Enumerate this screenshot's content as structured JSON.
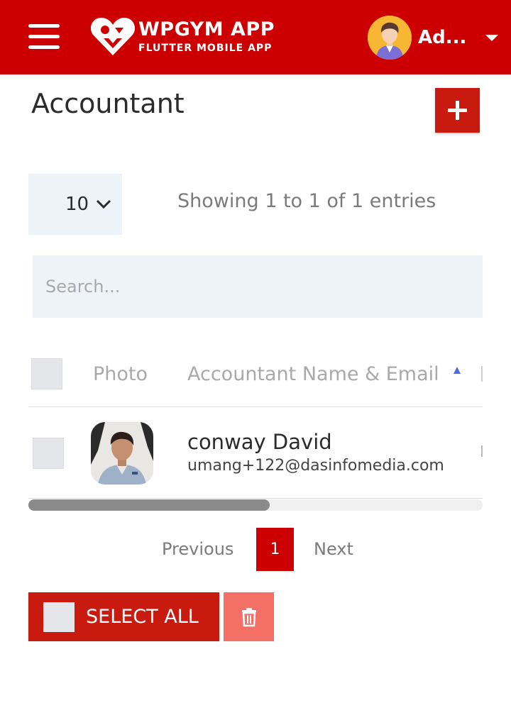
{
  "header": {
    "brand_title": "WPGYM APP",
    "brand_subtitle": "FLUTTER MOBILE APP",
    "user_name": "Ad...",
    "icons": [
      "menu-icon",
      "heart-logo",
      "user-avatar",
      "caret-down-icon"
    ],
    "bar_color": "#cc0000"
  },
  "page": {
    "title": "Accountant",
    "add_icon": "plus-icon"
  },
  "table_controls": {
    "page_length": "10",
    "entries_info": "Showing 1 to 1 of 1 entries",
    "search_placeholder": "Search..."
  },
  "table": {
    "columns": [
      "Photo",
      "Accountant Name & Email"
    ],
    "rows": [
      {
        "name": "conway David",
        "email": "umang+122@dasinfomedia.com"
      }
    ]
  },
  "pagination": {
    "previous": "Previous",
    "current_page": "1",
    "next": "Next"
  },
  "bulk_actions": {
    "select_all": "SELECT ALL",
    "delete_icon": "trash-icon"
  }
}
